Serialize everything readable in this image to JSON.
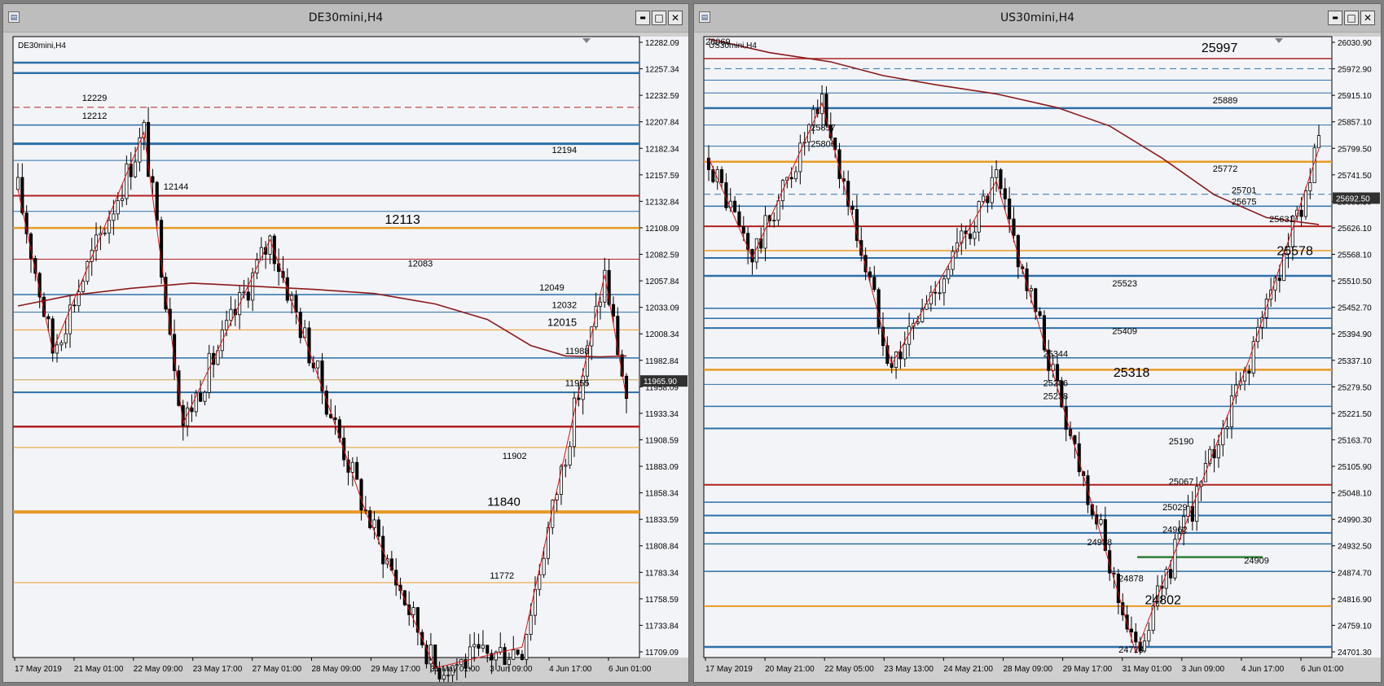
{
  "windows": [
    {
      "id": "de30",
      "title": "DE30mini,H4",
      "chart_label": "DE30mini,H4",
      "buttons": {
        "minimize": "▬",
        "maximize": "□",
        "close": "✕"
      },
      "chart_data": {
        "type": "candlestick",
        "symbol": "DE30mini",
        "timeframe": "H4",
        "ylim": [
          11700,
          12297
        ],
        "y_ticks": [
          "12282.09",
          "12257.34",
          "12232.59",
          "12207.84",
          "12182.34",
          "12157.59",
          "12132.84",
          "12108.09",
          "12082.59",
          "12057.84",
          "12033.09",
          "12008.34",
          "11982.84",
          "11958.09",
          "11933.34",
          "11908.59",
          "11883.09",
          "11858.34",
          "11833.59",
          "11808.84",
          "11783.34",
          "11758.59",
          "11733.84",
          "11709.09"
        ],
        "x_labels": [
          "17 May 2019",
          "21 May 01:00",
          "22 May 09:00",
          "23 May 17:00",
          "27 May 01:00",
          "28 May 09:00",
          "29 May 17:00",
          "31 May 01:00",
          "3 Jun 09:00",
          "4 Jun 17:00",
          "6 Jun 01:00"
        ],
        "current_price": "11965.90",
        "corner_label": "",
        "levels": [
          {
            "price": 12272,
            "color": "#2c6fa8",
            "width": 2.5,
            "dash": false
          },
          {
            "price": 12262,
            "color": "#2c6fa8",
            "width": 2.5,
            "dash": false
          },
          {
            "price": 12229,
            "color": "#b02020",
            "width": 1,
            "dash": true
          },
          {
            "price": 12212,
            "color": "#2c6fa8",
            "width": 1.5,
            "dash": false
          },
          {
            "price": 12194,
            "color": "#2c6fa8",
            "width": 3,
            "dash": false
          },
          {
            "price": 12178,
            "color": "#2c6fa8",
            "width": 1,
            "dash": false
          },
          {
            "price": 12144,
            "color": "#b02020",
            "width": 2,
            "dash": false
          },
          {
            "price": 12129,
            "color": "#2c6fa8",
            "width": 1,
            "dash": false
          },
          {
            "price": 12113,
            "color": "#e89a24",
            "width": 2.5,
            "dash": false
          },
          {
            "price": 12083,
            "color": "#b02020",
            "width": 1,
            "dash": false
          },
          {
            "price": 12049,
            "color": "#2c6fa8",
            "width": 1.5,
            "dash": false
          },
          {
            "price": 12032,
            "color": "#2c6fa8",
            "width": 1,
            "dash": false
          },
          {
            "price": 12015,
            "color": "#e89a24",
            "width": 1,
            "dash": false
          },
          {
            "price": 11988,
            "color": "#2c6fa8",
            "width": 1.5,
            "dash": false
          },
          {
            "price": 11967,
            "color": "#c8a050",
            "width": 1,
            "dash": false
          },
          {
            "price": 11955,
            "color": "#2c6fa8",
            "width": 2,
            "dash": false
          },
          {
            "price": 11922,
            "color": "#b02020",
            "width": 2.5,
            "dash": false
          },
          {
            "price": 11902,
            "color": "#e89a24",
            "width": 1,
            "dash": false
          },
          {
            "price": 11840,
            "color": "#e89a24",
            "width": 4,
            "dash": false
          },
          {
            "price": 11772,
            "color": "#e89a24",
            "width": 1,
            "dash": false
          }
        ],
        "labels": [
          {
            "text": "12229",
            "price": 12235,
            "pos": 0.15,
            "size": 11
          },
          {
            "text": "12212",
            "price": 12218,
            "pos": 0.15,
            "size": 11
          },
          {
            "text": "12194",
            "price": 12185,
            "pos": 0.9,
            "size": 11
          },
          {
            "text": "12144",
            "price": 12150,
            "pos": 0.28,
            "size": 11
          },
          {
            "text": "12113",
            "price": 12117,
            "pos": 0.65,
            "size": 16
          },
          {
            "text": "12083",
            "price": 12076,
            "pos": 0.67,
            "size": 11
          },
          {
            "text": "12049",
            "price": 12053,
            "pos": 0.88,
            "size": 11
          },
          {
            "text": "12032",
            "price": 12036,
            "pos": 0.9,
            "size": 11
          },
          {
            "text": "12015",
            "price": 12019,
            "pos": 0.9,
            "size": 13
          },
          {
            "text": "11988",
            "price": 11992,
            "pos": 0.92,
            "size": 11
          },
          {
            "text": "11955",
            "price": 11961,
            "pos": 0.92,
            "size": 11
          },
          {
            "text": "11902",
            "price": 11891,
            "pos": 0.82,
            "size": 11
          },
          {
            "text": "11840",
            "price": 11846,
            "pos": 0.81,
            "size": 15
          },
          {
            "text": "11772",
            "price": 11776,
            "pos": 0.8,
            "size": 11
          }
        ],
        "ma_points": [
          {
            "i": 0,
            "p": 12038
          },
          {
            "i": 12,
            "p": 12048
          },
          {
            "i": 26,
            "p": 12055
          },
          {
            "i": 40,
            "p": 12060
          },
          {
            "i": 54,
            "p": 12057
          },
          {
            "i": 68,
            "p": 12054
          },
          {
            "i": 82,
            "p": 12050
          },
          {
            "i": 96,
            "p": 12040
          },
          {
            "i": 108,
            "p": 12025
          },
          {
            "i": 118,
            "p": 12000
          },
          {
            "i": 126,
            "p": 11990
          },
          {
            "i": 134,
            "p": 11989
          },
          {
            "i": 140,
            "p": 11990
          }
        ],
        "zigzag": [
          {
            "i": 0,
            "p": 12150
          },
          {
            "i": 8,
            "p": 11995
          },
          {
            "i": 29,
            "p": 12205
          },
          {
            "i": 38,
            "p": 11925
          },
          {
            "i": 58,
            "p": 12102
          },
          {
            "i": 80,
            "p": 11840
          },
          {
            "i": 96,
            "p": 11690
          },
          {
            "i": 116,
            "p": 11710
          },
          {
            "i": 135,
            "p": 12068
          },
          {
            "i": 140,
            "p": 11950
          }
        ]
      }
    },
    {
      "id": "us30",
      "title": "US30mini,H4",
      "chart_label": "US30mini,H4",
      "buttons": {
        "minimize": "▬",
        "maximize": "□",
        "close": "✕"
      },
      "chart_data": {
        "type": "candlestick",
        "symbol": "US30mini",
        "timeframe": "H4",
        "ylim": [
          24690,
          26045
        ],
        "y_ticks": [
          "26030.90",
          "25972.90",
          "25915.10",
          "25857.10",
          "25799.50",
          "25741.50",
          "25683.50",
          "25626.10",
          "25568.10",
          "25510.50",
          "25452.70",
          "25394.90",
          "25337.10",
          "25279.50",
          "25221.50",
          "25163.70",
          "25105.90",
          "25048.10",
          "24990.30",
          "24932.50",
          "24874.70",
          "24816.90",
          "24759.10",
          "24701.30"
        ],
        "x_labels": [
          "17 May 2019",
          "20 May 21:00",
          "22 May 05:00",
          "23 May 13:00",
          "24 May 21:00",
          "28 May 09:00",
          "29 May 17:00",
          "31 May 01:00",
          "3 Jun 09:00",
          "4 Jun 17:00",
          "6 Jun 01:00"
        ],
        "current_price": "25692.50",
        "corner_label": "26069",
        "levels": [
          {
            "price": 25997,
            "color": "#b02020",
            "width": 1.5,
            "dash": false
          },
          {
            "price": 25975,
            "color": "#2c6fa8",
            "width": 1,
            "dash": true
          },
          {
            "price": 25950,
            "color": "#2c6fa8",
            "width": 1,
            "dash": false
          },
          {
            "price": 25922,
            "color": "#2c6fa8",
            "width": 1,
            "dash": false
          },
          {
            "price": 25889,
            "color": "#2c6fa8",
            "width": 2.5,
            "dash": false
          },
          {
            "price": 25852,
            "color": "#2c6fa8",
            "width": 1,
            "dash": false
          },
          {
            "price": 25806,
            "color": "#2c6fa8",
            "width": 1,
            "dash": false
          },
          {
            "price": 25772,
            "color": "#e89a24",
            "width": 2.5,
            "dash": false
          },
          {
            "price": 25701,
            "color": "#2c6fa8",
            "width": 1,
            "dash": true
          },
          {
            "price": 25675,
            "color": "#2c6fa8",
            "width": 1.5,
            "dash": false
          },
          {
            "price": 25631,
            "color": "#b02020",
            "width": 2,
            "dash": false
          },
          {
            "price": 25578,
            "color": "#e89a24",
            "width": 1.5,
            "dash": false
          },
          {
            "price": 25562,
            "color": "#2c6fa8",
            "width": 2,
            "dash": false
          },
          {
            "price": 25523,
            "color": "#2c6fa8",
            "width": 2.5,
            "dash": false
          },
          {
            "price": 25452,
            "color": "#2c6fa8",
            "width": 1.5,
            "dash": false
          },
          {
            "price": 25430,
            "color": "#2c6fa8",
            "width": 1.5,
            "dash": false
          },
          {
            "price": 25409,
            "color": "#2c6fa8",
            "width": 2,
            "dash": false
          },
          {
            "price": 25344,
            "color": "#2c6fa8",
            "width": 1.5,
            "dash": false
          },
          {
            "price": 25318,
            "color": "#e89a24",
            "width": 2.5,
            "dash": false
          },
          {
            "price": 25286,
            "color": "#2c6fa8",
            "width": 1,
            "dash": false
          },
          {
            "price": 25238,
            "color": "#2c6fa8",
            "width": 1.5,
            "dash": false
          },
          {
            "price": 25190,
            "color": "#2c6fa8",
            "width": 2,
            "dash": false
          },
          {
            "price": 25067,
            "color": "#b02020",
            "width": 2,
            "dash": false
          },
          {
            "price": 25029,
            "color": "#2c6fa8",
            "width": 1.5,
            "dash": false
          },
          {
            "price": 25000,
            "color": "#2c6fa8",
            "width": 2,
            "dash": false
          },
          {
            "price": 24962,
            "color": "#2c6fa8",
            "width": 2,
            "dash": false
          },
          {
            "price": 24938,
            "color": "#2c6fa8",
            "width": 1.5,
            "dash": false
          },
          {
            "price": 24878,
            "color": "#2c6fa8",
            "width": 1.5,
            "dash": false
          },
          {
            "price": 24802,
            "color": "#e89a24",
            "width": 2,
            "dash": false
          },
          {
            "price": 24713,
            "color": "#2c6fa8",
            "width": 2.5,
            "dash": false
          }
        ],
        "segments": [
          {
            "price": 24909,
            "from": 0.69,
            "to": 0.89,
            "color": "#2e7d3a",
            "width": 2.5
          }
        ],
        "labels": [
          {
            "text": "25997",
            "price": 26011,
            "pos": 0.85,
            "size": 16
          },
          {
            "text": "25889",
            "price": 25899,
            "pos": 0.85,
            "size": 11
          },
          {
            "text": "25857",
            "price": 25840,
            "pos": 0.21,
            "size": 11
          },
          {
            "text": "25806",
            "price": 25804,
            "pos": 0.21,
            "size": 11
          },
          {
            "text": "25772",
            "price": 25750,
            "pos": 0.85,
            "size": 11
          },
          {
            "text": "25701",
            "price": 25703,
            "pos": 0.88,
            "size": 11
          },
          {
            "text": "25675",
            "price": 25678,
            "pos": 0.88,
            "size": 11
          },
          {
            "text": "25631",
            "price": 25640,
            "pos": 0.94,
            "size": 11
          },
          {
            "text": "25578",
            "price": 25568,
            "pos": 0.97,
            "size": 16
          },
          {
            "text": "25523",
            "price": 25500,
            "pos": 0.69,
            "size": 11
          },
          {
            "text": "25409",
            "price": 25396,
            "pos": 0.69,
            "size": 11
          },
          {
            "text": "25344",
            "price": 25346,
            "pos": 0.58,
            "size": 11
          },
          {
            "text": "25318",
            "price": 25303,
            "pos": 0.71,
            "size": 16
          },
          {
            "text": "25286",
            "price": 25282,
            "pos": 0.58,
            "size": 11
          },
          {
            "text": "25238",
            "price": 25254,
            "pos": 0.58,
            "size": 11
          },
          {
            "text": "25190",
            "price": 25155,
            "pos": 0.78,
            "size": 11
          },
          {
            "text": "25067",
            "price": 25067,
            "pos": 0.78,
            "size": 11
          },
          {
            "text": "25029",
            "price": 25011,
            "pos": 0.77,
            "size": 11
          },
          {
            "text": "24962",
            "price": 24963,
            "pos": 0.77,
            "size": 11
          },
          {
            "text": "24938",
            "price": 24935,
            "pos": 0.65,
            "size": 11
          },
          {
            "text": "24909",
            "price": 24895,
            "pos": 0.9,
            "size": 11
          },
          {
            "text": "24878",
            "price": 24856,
            "pos": 0.7,
            "size": 11
          },
          {
            "text": "24802",
            "price": 24806,
            "pos": 0.76,
            "size": 16
          },
          {
            "text": "24713",
            "price": 24701,
            "pos": 0.7,
            "size": 11
          }
        ],
        "ma_points": [
          {
            "i": 0,
            "p": 26040
          },
          {
            "i": 14,
            "p": 26010
          },
          {
            "i": 28,
            "p": 25990
          },
          {
            "i": 40,
            "p": 25960
          },
          {
            "i": 52,
            "p": 25940
          },
          {
            "i": 66,
            "p": 25920
          },
          {
            "i": 80,
            "p": 25890
          },
          {
            "i": 92,
            "p": 25850
          },
          {
            "i": 104,
            "p": 25780
          },
          {
            "i": 116,
            "p": 25700
          },
          {
            "i": 128,
            "p": 25650
          },
          {
            "i": 140,
            "p": 25635
          }
        ],
        "zigzag": [
          {
            "i": 0,
            "p": 25780
          },
          {
            "i": 10,
            "p": 25562
          },
          {
            "i": 26,
            "p": 25900
          },
          {
            "i": 42,
            "p": 25330
          },
          {
            "i": 66,
            "p": 25730
          },
          {
            "i": 98,
            "p": 24700
          },
          {
            "i": 124,
            "p": 25340
          },
          {
            "i": 140,
            "p": 25800
          }
        ]
      }
    }
  ]
}
